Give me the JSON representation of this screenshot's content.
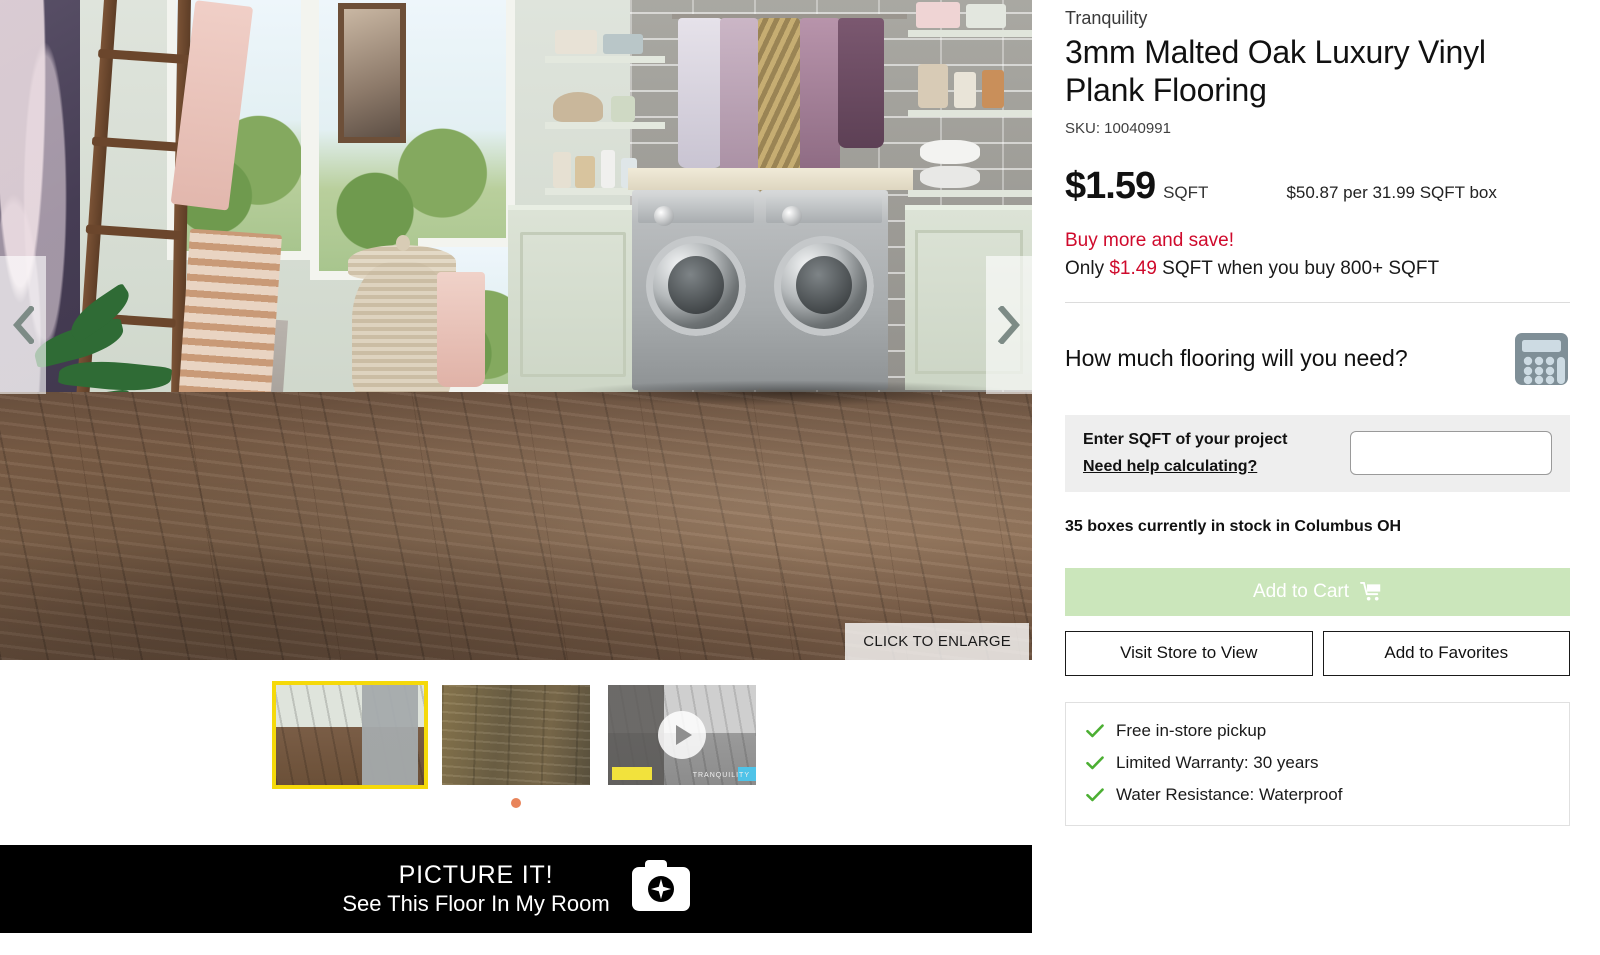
{
  "product": {
    "brand": "Tranquility",
    "title": "3mm Malted Oak Luxury Vinyl Plank Flooring",
    "sku": "SKU: 10040991",
    "price": "$1.59",
    "price_unit": "SQFT",
    "box_price": "$50.87 per  31.99 SQFT box"
  },
  "promo": {
    "headline": "Buy more and save!",
    "only": "Only ",
    "sale_price": "$1.49",
    "rest": " SQFT when you buy 800+ SQFT",
    "accent_color": "#cf0a2c"
  },
  "calculator": {
    "question": "How much flooring will you need?",
    "icon": "calculator-icon"
  },
  "sqft": {
    "label": "Enter SQFT of your project",
    "help_link": "Need help calculating?",
    "input_value": "",
    "input_placeholder": ""
  },
  "stock": {
    "text": "35 boxes currently in stock in Columbus OH"
  },
  "actions": {
    "add_to_cart": "Add to Cart",
    "add_to_cart_color": "#cbe6bb",
    "cart_icon": "shopping-cart-icon",
    "visit_store": "Visit Store to View",
    "add_to_favorites": "Add to Favorites"
  },
  "features": {
    "check_color": "#4caf33",
    "items": [
      "Free in-store pickup",
      "Limited Warranty: 30 years",
      "Water Resistance: Waterproof"
    ]
  },
  "gallery": {
    "enlarge_label": "CLICK TO ENLARGE",
    "prev_icon": "chevron-left-icon",
    "next_icon": "chevron-right-icon",
    "active_thumb_color": "#f5d90a",
    "dot_color": "#e8845a",
    "thumbs": [
      {
        "name": "laundry-room-scene",
        "type": "image"
      },
      {
        "name": "plank-closeup",
        "type": "image"
      },
      {
        "name": "kitchen-video",
        "type": "video",
        "watermark": "TRANQUILITY"
      }
    ]
  },
  "picture_it": {
    "title": "PICTURE IT!",
    "subtitle": "See This Floor In My Room",
    "icon": "camera-sparkle-icon"
  }
}
